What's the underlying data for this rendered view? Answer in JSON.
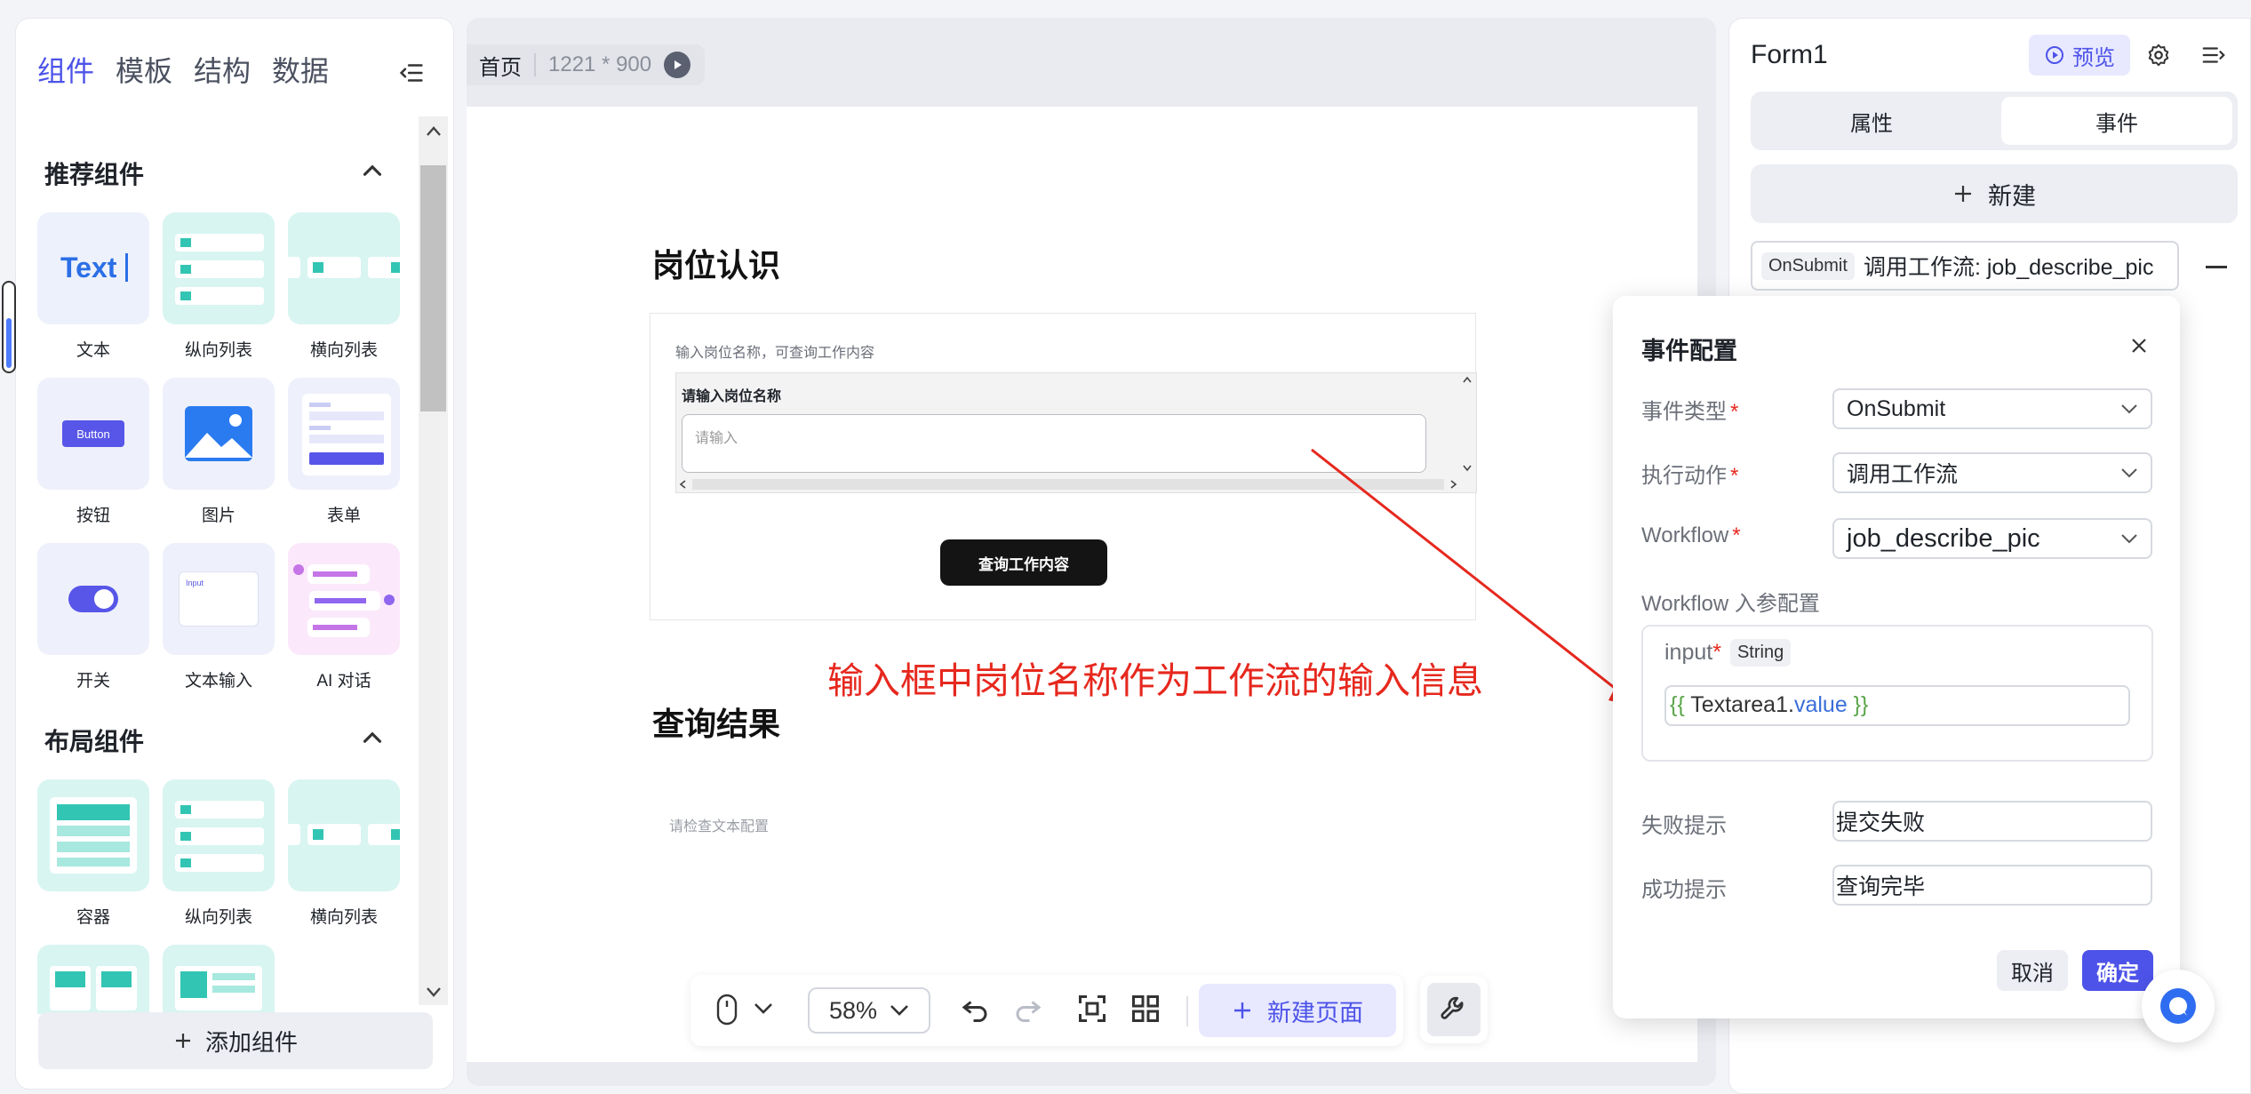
{
  "left_panel": {
    "tabs": [
      {
        "label": "组件",
        "active": true
      },
      {
        "label": "模板",
        "active": false
      },
      {
        "label": "结构",
        "active": false
      },
      {
        "label": "数据",
        "active": false
      }
    ],
    "sections": [
      {
        "title": "推荐组件",
        "items": [
          {
            "label": "文本",
            "icon": "text-icon"
          },
          {
            "label": "纵向列表",
            "icon": "vertical-list-icon"
          },
          {
            "label": "横向列表",
            "icon": "horizontal-list-icon"
          },
          {
            "label": "按钮",
            "icon": "button-icon"
          },
          {
            "label": "图片",
            "icon": "image-icon"
          },
          {
            "label": "表单",
            "icon": "form-icon"
          },
          {
            "label": "开关",
            "icon": "switch-icon"
          },
          {
            "label": "文本输入",
            "icon": "text-input-icon"
          },
          {
            "label": "AI 对话",
            "icon": "ai-chat-icon"
          }
        ]
      },
      {
        "title": "布局组件",
        "items": [
          {
            "label": "容器",
            "icon": "container-icon"
          },
          {
            "label": "纵向列表",
            "icon": "vertical-list-icon"
          },
          {
            "label": "横向列表",
            "icon": "horizontal-list-icon"
          }
        ]
      }
    ],
    "card_texts": {
      "text": "Text",
      "button": "Button",
      "input": "Input"
    },
    "add_component": "添加组件"
  },
  "canvas": {
    "page_name": "首页",
    "page_size": "1221 * 900",
    "section1_title": "岗位认识",
    "form_hint": "输入岗位名称，可查询工作内容",
    "form_label": "请输入岗位名称",
    "input_placeholder": "请输入",
    "query_button": "查询工作内容",
    "section2_title": "查询结果",
    "result_hint": "请检查文本配置",
    "annotation": "输入框中岗位名称作为工作流的输入信息"
  },
  "toolbar": {
    "zoom": "58%",
    "new_page": "新建页面"
  },
  "right_panel": {
    "title": "Form1",
    "preview": "预览",
    "tabs": [
      {
        "label": "属性",
        "active": false
      },
      {
        "label": "事件",
        "active": true
      }
    ],
    "new_button": "新建",
    "event_tag": "OnSubmit",
    "event_text": "调用工作流: job_describe_pic"
  },
  "dialog": {
    "title": "事件配置",
    "fields": {
      "event_type_label": "事件类型",
      "event_type_value": "OnSubmit",
      "action_label": "执行动作",
      "action_value": "调用工作流",
      "workflow_label": "Workflow",
      "workflow_value": "job_describe_pic",
      "params_label": "Workflow 入参配置",
      "param_name": "input",
      "param_type": "String",
      "param_expr_open": "{{ ",
      "param_expr_name": "Textarea1.",
      "param_expr_prop": "value",
      "param_expr_close": " }}",
      "fail_label": "失败提示",
      "fail_value": "提交失败",
      "success_label": "成功提示",
      "success_value": "查询完毕"
    },
    "cancel": "取消",
    "confirm": "确定"
  },
  "colors": {
    "accent": "#4d53e8",
    "annotation": "#e6281e",
    "teal_card": "#d8f5f1",
    "lilac_card": "#eef0fb"
  }
}
